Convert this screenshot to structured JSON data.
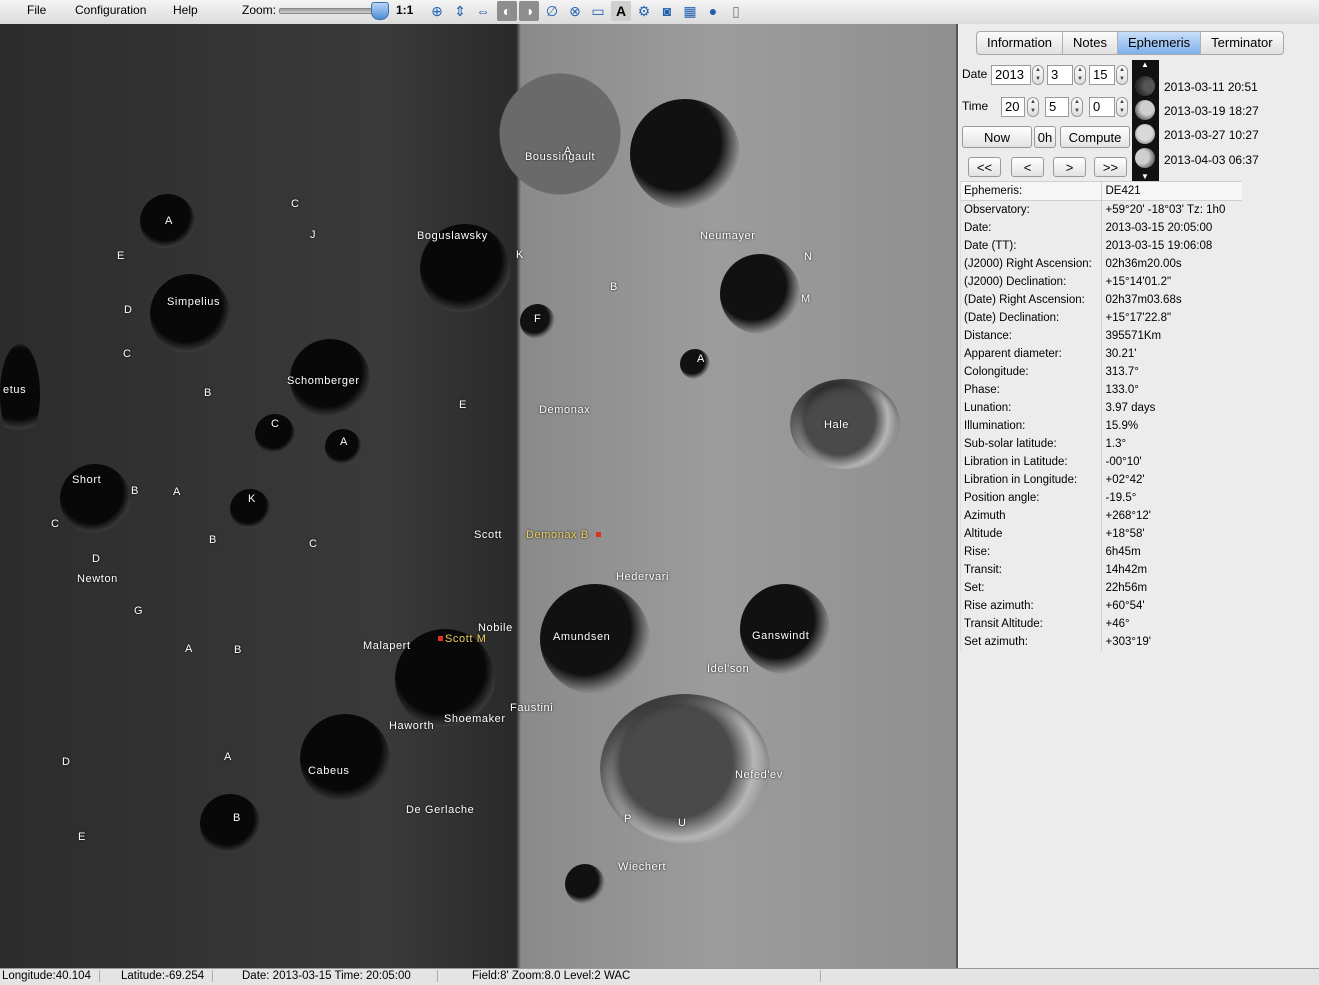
{
  "menu": {
    "file": "File",
    "configuration": "Configuration",
    "help": "Help"
  },
  "zoom": {
    "label": "Zoom:",
    "ratio": "1:1",
    "level": 0.9
  },
  "toolbar_icons": [
    "globe-grid-icon",
    "flip-vertical-icon",
    "flip-horizontal-icon",
    "earth-phase-icon",
    "moon-phase-icon",
    "sphere-grid-icon",
    "grid-icon",
    "ruler-icon",
    "label-text-icon",
    "settings-gear-icon",
    "camera-icon",
    "calendar-icon",
    "globe-icon",
    "document-icon"
  ],
  "tabs": [
    "Information",
    "Notes",
    "Ephemeris",
    "Terminator"
  ],
  "active_tab": "Ephemeris",
  "controls": {
    "date_label": "Date",
    "year": "2013",
    "month": "3",
    "day": "15",
    "time_label": "Time",
    "hour": "20",
    "minute": "5",
    "second": "0",
    "now": "Now",
    "zero_h": "0h",
    "compute": "Compute",
    "nav": [
      "<<",
      "<",
      ">",
      ">>"
    ]
  },
  "phases": [
    "2013-03-11 20:51",
    "2013-03-19 18:27",
    "2013-03-27 10:27",
    "2013-04-03 06:37"
  ],
  "ephemeris": {
    "head": [
      "Ephemeris:",
      "DE421"
    ],
    "rows": [
      [
        "Observatory:",
        "+59°20' -18°03'  Tz:  1h0"
      ],
      [
        "Date:",
        "2013-03-15 20:05:00"
      ],
      [
        "Date (TT):",
        "2013-03-15 19:06:08"
      ],
      [
        "(J2000) Right Ascension:",
        " 02h36m20.00s"
      ],
      [
        "(J2000) Declination:",
        "+15°14'01.2\""
      ],
      [
        "(Date) Right Ascension:",
        " 02h37m03.68s"
      ],
      [
        "(Date) Declination:",
        "+15°17'22.8\""
      ],
      [
        "Distance:",
        "395571Km"
      ],
      [
        "Apparent diameter:",
        "30.21'"
      ],
      [
        "Colongitude:",
        "313.7°"
      ],
      [
        "Phase:",
        "133.0°"
      ],
      [
        "Lunation:",
        "3.97 days"
      ],
      [
        "Illumination:",
        "15.9%"
      ],
      [
        "Sub-solar latitude:",
        "1.3°"
      ],
      [
        "Libration in Latitude:",
        "-00°10'"
      ],
      [
        "Libration in Longitude:",
        "+02°42'"
      ],
      [
        "Position angle:",
        "-19.5°"
      ],
      [
        "Azimuth",
        "+268°12'"
      ],
      [
        "Altitude",
        "+18°58'"
      ],
      [
        "Rise:",
        "  6h45m"
      ],
      [
        "Transit:",
        "  14h42m"
      ],
      [
        "Set:",
        "  22h56m"
      ],
      [
        "Rise azimuth:",
        "+60°54'"
      ],
      [
        "Transit Altitude:",
        "+46°"
      ],
      [
        "Set azimuth:",
        "+303°19'"
      ]
    ]
  },
  "map_labels": {
    "boussingault": "Boussingault",
    "a_bous": "A",
    "boguslawsky": "Boguslawsky",
    "neumayer": "Neumayer",
    "simpelius": "Simpelius",
    "schomberger": "Schomberger",
    "demonax": "Demonax",
    "hale": "Hale",
    "short": "Short",
    "newton": "Newton",
    "scott": "Scott",
    "demonax_b": "Demonax B",
    "hedervari": "Hedervari",
    "malapert": "Malapert",
    "scott_m": "Scott M",
    "nobile": "Nobile",
    "amundsen": "Amundsen",
    "ganswindt": "Ganswindt",
    "idelson": "Idel'son",
    "faustini": "Faustini",
    "haworth": "Haworth",
    "shoemaker": "Shoemaker",
    "cabeus": "Cabeus",
    "nefed_ev": "Nefed'ev",
    "de_gerlache": "De Gerlache",
    "wiechert": "Wiechert",
    "etus": "etus",
    "a1": "A",
    "c1": "C",
    "j1": "J",
    "e1": "E",
    "d1": "D",
    "c2": "C",
    "b1": "B",
    "c3": "C",
    "a2": "A",
    "e2": "E",
    "k1": "K",
    "b2": "B",
    "n1": "N",
    "m1": "M",
    "f1": "F",
    "a3": "A",
    "b3": "B",
    "a4": "A",
    "k2": "K",
    "c4": "C",
    "d2": "D",
    "b4": "B",
    "c5": "C",
    "g1": "G",
    "a5": "A",
    "b5": "B",
    "d3": "D",
    "a6": "A",
    "b6": "B",
    "e3": "E",
    "p1": "P",
    "u1": "U"
  },
  "status": {
    "longitude": "Longitude:40.104",
    "latitude": "Latitude:-69.254",
    "datetime": "Date: 2013-03-15   Time: 20:05:00",
    "field": "Field:8' Zoom:8.0  Level:2 WAC"
  }
}
